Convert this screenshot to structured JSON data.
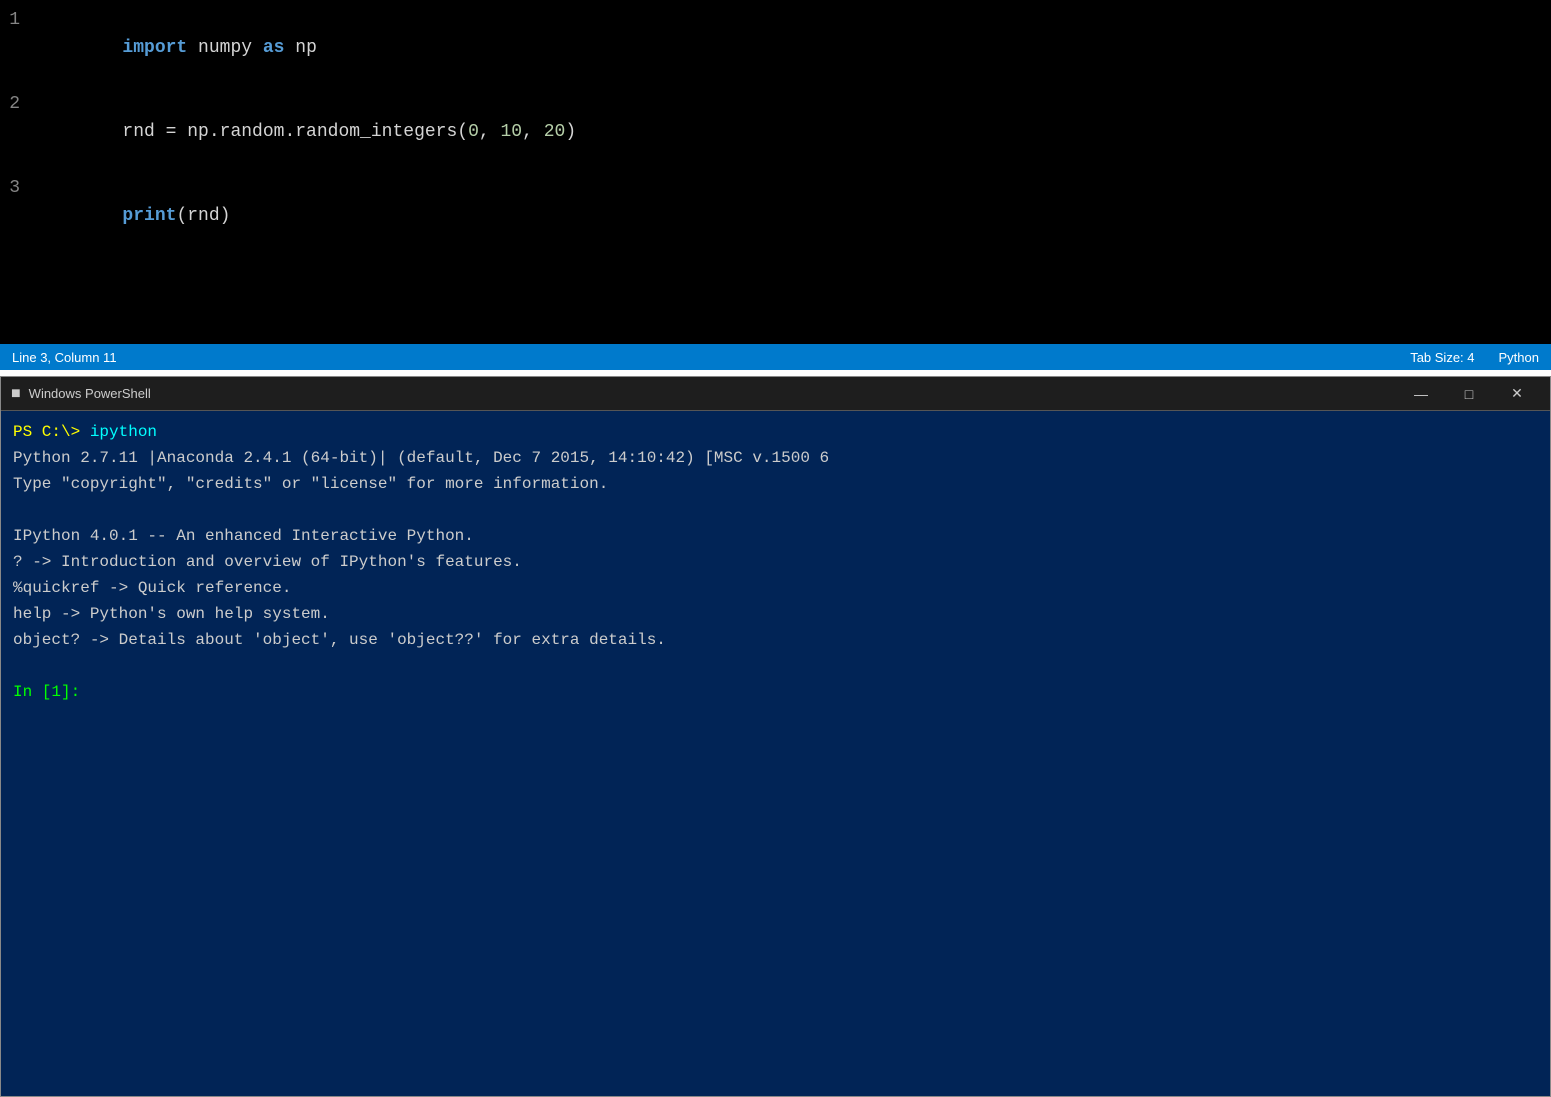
{
  "editor": {
    "background": "#000000",
    "lines": [
      {
        "number": "1",
        "tokens": [
          {
            "type": "kw-import",
            "text": "import"
          },
          {
            "type": "var-name",
            "text": " numpy "
          },
          {
            "type": "kw-as",
            "text": "as"
          },
          {
            "type": "var-name",
            "text": " np"
          }
        ]
      },
      {
        "number": "2",
        "tokens": [
          {
            "type": "var-name",
            "text": "rnd = np.random.random_integers("
          },
          {
            "type": "num-val",
            "text": "0"
          },
          {
            "type": "var-name",
            "text": ", "
          },
          {
            "type": "num-val",
            "text": "10"
          },
          {
            "type": "var-name",
            "text": ", "
          },
          {
            "type": "num-val",
            "text": "20"
          },
          {
            "type": "var-name",
            "text": ")"
          }
        ]
      },
      {
        "number": "3",
        "tokens": [
          {
            "type": "kw-print",
            "text": "print"
          },
          {
            "type": "var-name",
            "text": "(rnd)"
          }
        ]
      }
    ]
  },
  "statusbar": {
    "left": {
      "position": "Line 3, Column 11"
    },
    "right": {
      "tab_size": "Tab Size: 4",
      "language": "Python"
    }
  },
  "powershell": {
    "title": "Windows PowerShell",
    "titlebar_buttons": {
      "minimize": "—",
      "maximize": "□",
      "close": "✕"
    },
    "content_lines": [
      {
        "type": "prompt",
        "text": "PS C:\\> ",
        "command": "ipython"
      },
      {
        "type": "text",
        "text": "Python 2.7.11 |Anaconda 2.4.1 (64-bit)| (default, Dec  7 2015, 14:10:42) [MSC v.1500 6"
      },
      {
        "type": "text",
        "text": "Type \"copyright\", \"credits\" or \"license\" for more information."
      },
      {
        "type": "blank",
        "text": ""
      },
      {
        "type": "text",
        "text": "IPython 4.0.1 -- An enhanced Interactive Python."
      },
      {
        "type": "text",
        "text": "?         -> Introduction and overview of IPython's features."
      },
      {
        "type": "text",
        "text": "%quickref -> Quick reference."
      },
      {
        "type": "text",
        "text": "help      -> Python's own help system."
      },
      {
        "type": "text",
        "text": "object?   -> Details about 'object', use 'object??' for extra details."
      },
      {
        "type": "blank",
        "text": ""
      },
      {
        "type": "in-prompt",
        "text": "In [1]: "
      }
    ]
  }
}
